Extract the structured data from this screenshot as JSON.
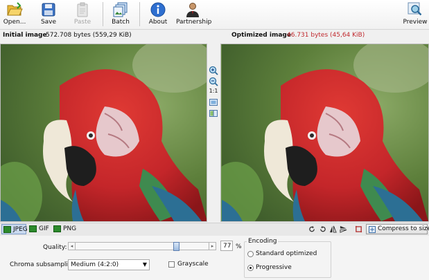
{
  "toolbar": {
    "open_label": "Open...",
    "save_label": "Save",
    "paste_label": "Paste",
    "batch_label": "Batch",
    "about_label": "About",
    "partnership_label": "Partnership",
    "preview_label": "Preview"
  },
  "initial": {
    "title": "Initial image",
    "size": "572.708 bytes (559,29 KiB)"
  },
  "optimized": {
    "title": "Optimized image",
    "size": "46.731 bytes (45,64 KiB)",
    "size_color": "#c0282d"
  },
  "midtools": {
    "actual_size_label": "1:1"
  },
  "formats": {
    "jpeg": "JPEG",
    "gif": "GIF",
    "png": "PNG",
    "active": "JPEG"
  },
  "compress_label": "Compress to size",
  "settings": {
    "quality_label": "Quality:",
    "quality_value": "77",
    "quality_unit": "%",
    "quality_fraction": 0.77,
    "chroma_label": "Chroma subsampling:",
    "chroma_value": "Medium (4:2:0)",
    "grayscale_label": "Grayscale",
    "encoding_title": "Encoding",
    "standard_label": "Standard optimized",
    "progressive_label": "Progressive",
    "selected_encoding": "Progressive"
  },
  "colors": {
    "accent_blue": "#2e6fd0",
    "parrot_red": "#c4262a",
    "foliage_green": "#5f8c3a"
  }
}
